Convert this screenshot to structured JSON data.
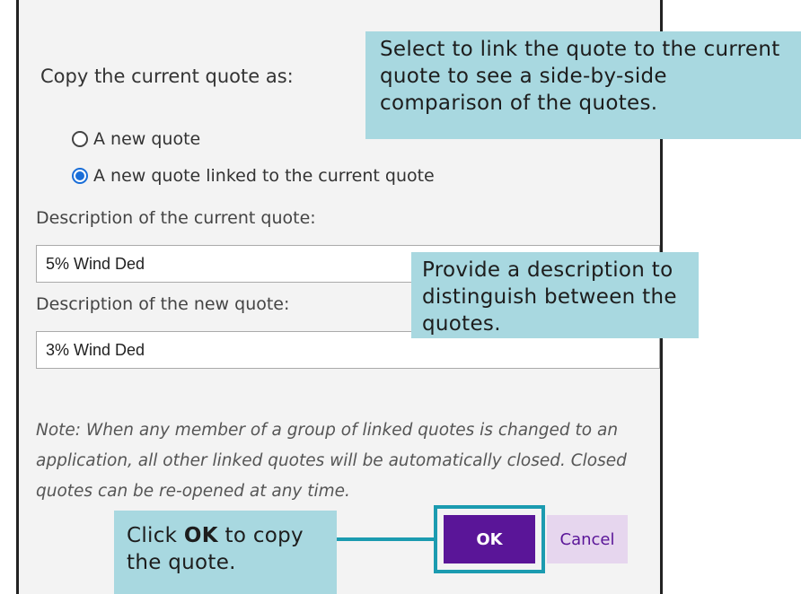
{
  "dialog": {
    "heading": "Copy the current quote as:",
    "options": [
      {
        "label": "A new quote",
        "checked": false
      },
      {
        "label": "A new quote linked to the current quote",
        "checked": true
      }
    ],
    "current_desc_label": "Description of the current quote:",
    "current_desc_value": "5% Wind Ded",
    "new_desc_label": "Description of the new quote:",
    "new_desc_value": "3% Wind Ded",
    "note": "Note: When any member of a group of linked quotes is changed to an application, all other linked quotes will be automatically closed. Closed quotes can be re-opened at any time.",
    "ok_label": "OK",
    "cancel_label": "Cancel"
  },
  "callouts": {
    "link": "Select to link the quote to the current quote to see a side-by-side comparison of the quotes.",
    "description": "Provide a description to distinguish between the quotes.",
    "ok_prefix": "Click ",
    "ok_bold": "OK",
    "ok_suffix": " to copy the quote."
  },
  "colors": {
    "callout_bg": "#a8d8e0",
    "highlight": "#1b9bb0",
    "ok_bg": "#5a1598",
    "cancel_bg": "#e6d6ee",
    "radio_checked": "#1a6ed8"
  }
}
